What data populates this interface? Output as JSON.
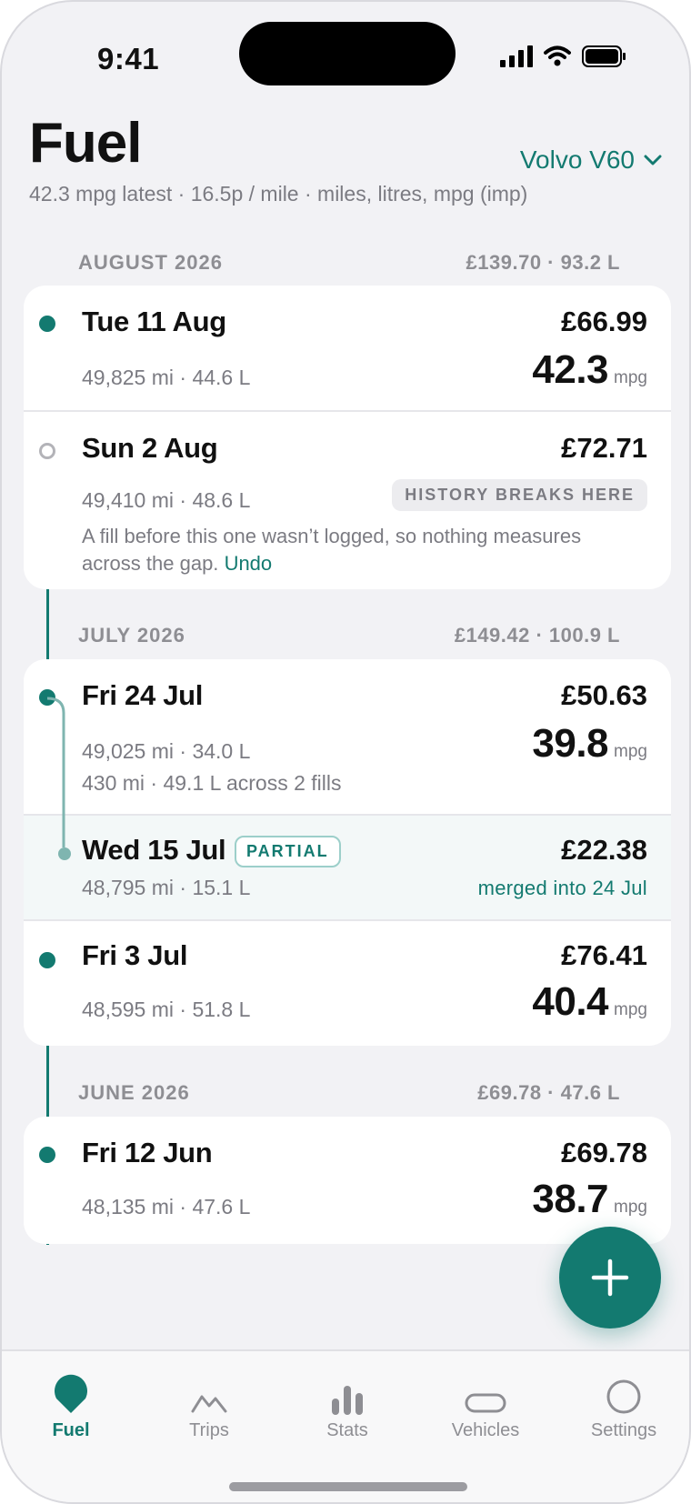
{
  "status": {
    "time": "9:41"
  },
  "header": {
    "title": "Fuel",
    "vehicle": "Volvo V60",
    "subtitle": "42.3 mpg latest · 16.5p / mile · miles, litres, mpg (imp)"
  },
  "months": [
    {
      "label": "AUGUST 2026",
      "totals": "£139.70 · 93.2 L",
      "fills": [
        {
          "date": "Tue 11 Aug",
          "meta": "49,825 mi · 44.6 L",
          "price": "£66.99",
          "mpg": "42.3",
          "unit": "mpg"
        },
        {
          "date": "Sun 2 Aug",
          "meta": "49,410 mi · 48.6 L",
          "price": "£72.71",
          "badge": "HISTORY BREAKS HERE",
          "note": "A fill before this one wasn’t logged, so nothing measures across the gap.",
          "undo": "Undo"
        }
      ]
    },
    {
      "label": "JULY 2026",
      "totals": "£149.42 · 100.9 L",
      "fills": [
        {
          "date": "Fri 24 Jul",
          "meta": "49,025 mi · 34.0 L",
          "extra": "430 mi · 49.1 L across 2 fills",
          "price": "£50.63",
          "mpg": "39.8",
          "unit": "mpg"
        },
        {
          "date": "Wed 15 Jul",
          "badge": "PARTIAL",
          "meta": "48,795 mi · 15.1 L",
          "price": "£22.38",
          "merged": "merged into 24 Jul"
        },
        {
          "date": "Fri 3 Jul",
          "meta": "48,595 mi · 51.8 L",
          "price": "£76.41",
          "mpg": "40.4",
          "unit": "mpg"
        }
      ]
    },
    {
      "label": "JUNE 2026",
      "totals": "£69.78 · 47.6 L",
      "fills": [
        {
          "date": "Fri 12 Jun",
          "meta": "48,135 mi · 47.6 L",
          "price": "£69.78",
          "mpg": "38.7",
          "unit": "mpg"
        }
      ]
    }
  ],
  "tabs": [
    {
      "label": "Fuel",
      "icon": "fuel-drop-icon",
      "active": true
    },
    {
      "label": "Trips",
      "icon": "trips-mountain-icon"
    },
    {
      "label": "Stats",
      "icon": "stats-bars-icon"
    },
    {
      "label": "Vehicles",
      "icon": "vehicle-icon"
    },
    {
      "label": "Settings",
      "icon": "settings-circle-icon"
    }
  ],
  "colors": {
    "accent": "#137a70",
    "background": "#f2f2f5",
    "muted": "#7b7b82"
  }
}
